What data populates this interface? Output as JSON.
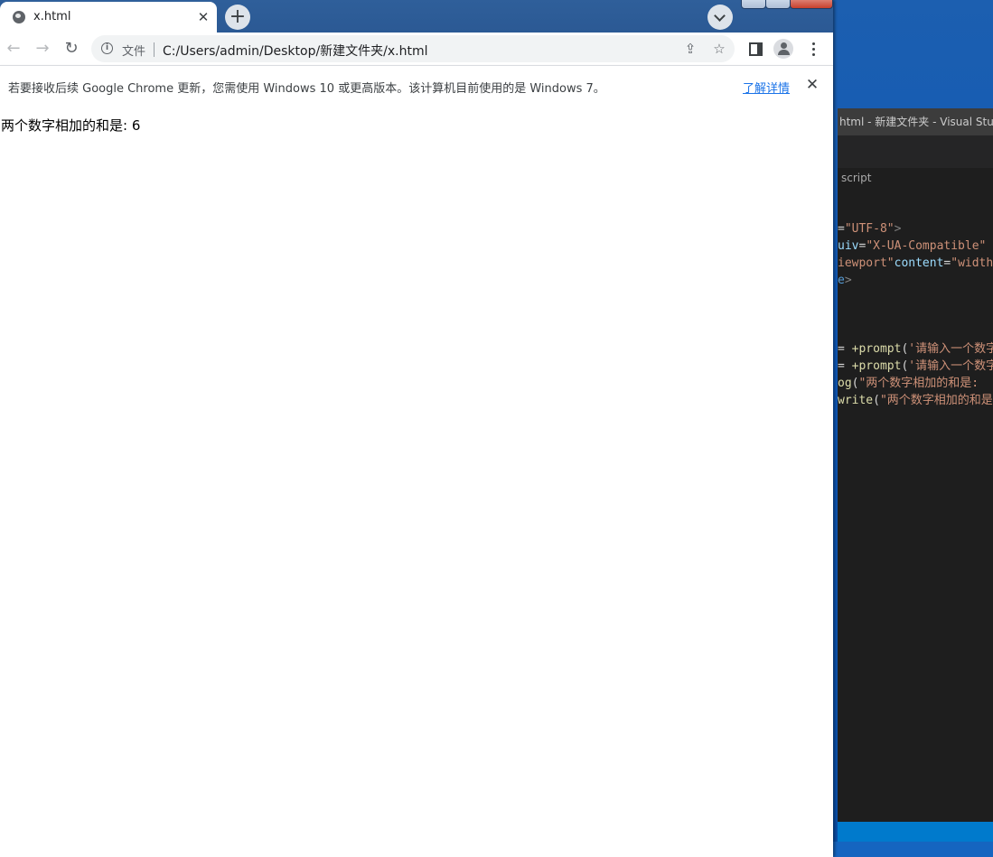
{
  "browser": {
    "tab": {
      "title": "x.html",
      "close_glyph": "✕"
    },
    "new_tab_glyph": "+",
    "nav": {
      "back": "←",
      "forward": "→",
      "reload": "↻"
    },
    "address": {
      "info_icon": "info-icon",
      "scheme_label": "文件",
      "url": "C:/Users/admin/Desktop/新建文件夹/x.html",
      "share_icon": "⇪",
      "bookmark_icon": "☆"
    },
    "infobar": {
      "message": "若要接收后续 Google Chrome 更新，您需使用 Windows 10 或更高版本。该计算机目前使用的是 Windows 7。",
      "link": "了解详情",
      "close_glyph": "✕"
    }
  },
  "page": {
    "output": "两个数字相加的和是: 6"
  },
  "editor": {
    "title": "html - 新建文件夹 - Visual Studio",
    "breadcrumb": "script",
    "code_lines": [
      {
        "parts": [
          {
            "t": "=",
            "c": "#d4d4d4"
          },
          {
            "t": "\"UTF-8\"",
            "c": "#ce9178"
          },
          {
            "t": ">",
            "c": "#808080"
          }
        ]
      },
      {
        "parts": [
          {
            "t": "uiv",
            "c": "#9cdcfe"
          },
          {
            "t": "=",
            "c": "#d4d4d4"
          },
          {
            "t": "\"X-UA-Compatible\"",
            "c": "#ce9178"
          },
          {
            "t": " c",
            "c": "#9cdcfe"
          }
        ]
      },
      {
        "parts": [
          {
            "t": "iewport\"",
            "c": "#ce9178"
          },
          {
            "t": "content",
            "c": "#9cdcfe"
          },
          {
            "t": "=",
            "c": "#d4d4d4"
          },
          {
            "t": "\"width-",
            "c": "#ce9178"
          }
        ]
      },
      {
        "parts": [
          {
            "t": "e",
            "c": "#569cd6"
          },
          {
            "t": ">",
            "c": "#808080"
          }
        ]
      },
      {
        "parts": []
      },
      {
        "parts": []
      },
      {
        "parts": []
      },
      {
        "parts": [
          {
            "t": "= ",
            "c": "#d4d4d4"
          },
          {
            "t": "+prompt",
            "c": "#dcdcaa"
          },
          {
            "t": "(",
            "c": "#d4d4d4"
          },
          {
            "t": "'请输入一个数字",
            "c": "#ce9178"
          }
        ]
      },
      {
        "parts": [
          {
            "t": "= ",
            "c": "#d4d4d4"
          },
          {
            "t": "+prompt",
            "c": "#dcdcaa"
          },
          {
            "t": "(",
            "c": "#d4d4d4"
          },
          {
            "t": "'请输入一个数字",
            "c": "#ce9178"
          }
        ]
      },
      {
        "parts": [
          {
            "t": "og",
            "c": "#dcdcaa"
          },
          {
            "t": "(",
            "c": "#d4d4d4"
          },
          {
            "t": "\"两个数字相加的和是: ",
            "c": "#ce9178"
          }
        ]
      },
      {
        "parts": [
          {
            "t": "write",
            "c": "#dcdcaa"
          },
          {
            "t": "(",
            "c": "#d4d4d4"
          },
          {
            "t": "\"两个数字相加的和是",
            "c": "#ce9178"
          }
        ]
      }
    ]
  }
}
